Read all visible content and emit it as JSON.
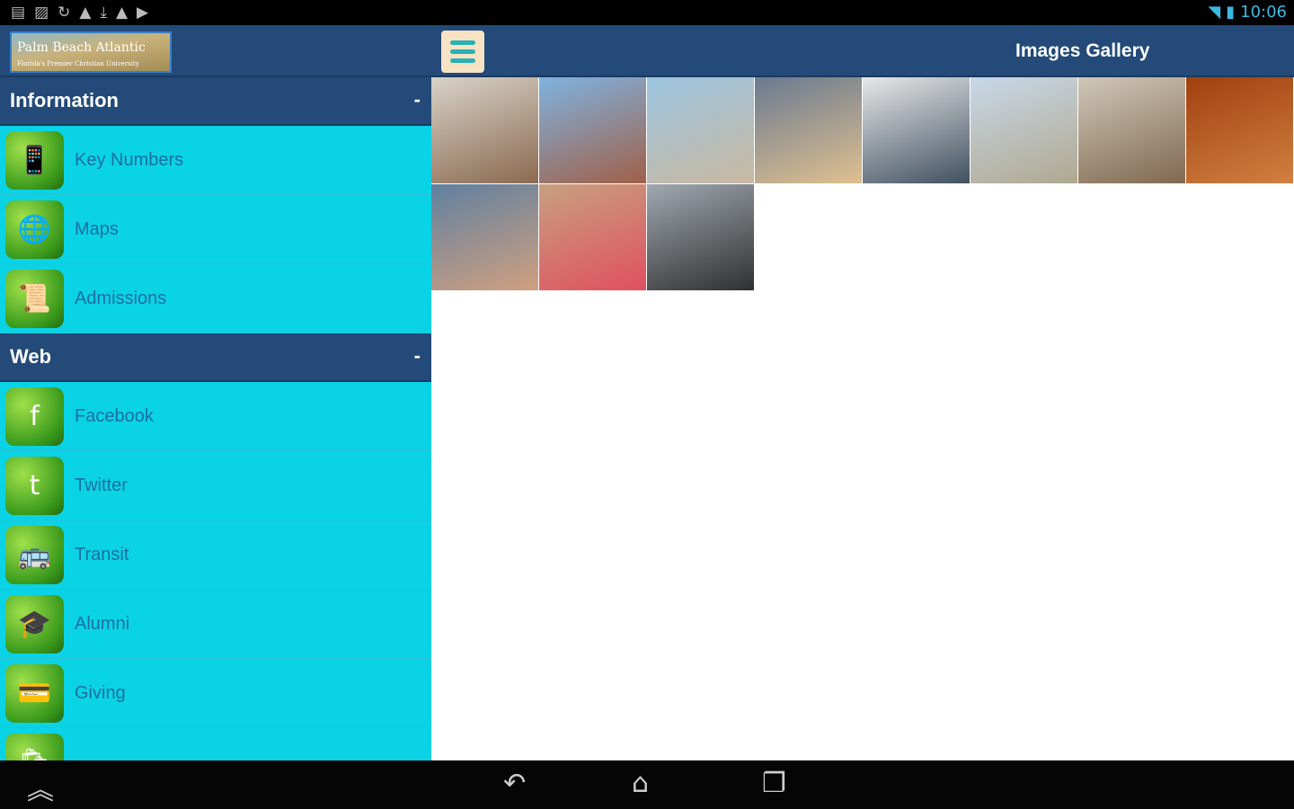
{
  "status_bar": {
    "time": "10:06",
    "icons": [
      "notes-icon",
      "image-icon",
      "sync-icon",
      "warning-icon",
      "download-icon",
      "warning-icon",
      "play-store-icon"
    ]
  },
  "header": {
    "logo_title": "Palm Beach Atlantic",
    "logo_subtitle": "Florida's Premier Christian University",
    "title": "Images Gallery"
  },
  "sidebar": {
    "sections": [
      {
        "title": "Information",
        "toggle": "-",
        "items": [
          {
            "label": "Key Numbers",
            "icon": "📱"
          },
          {
            "label": "Maps",
            "icon": "🌐"
          },
          {
            "label": "Admissions",
            "icon": "📜"
          }
        ]
      },
      {
        "title": "Web",
        "toggle": "-",
        "items": [
          {
            "label": "Facebook",
            "icon": "f"
          },
          {
            "label": "Twitter",
            "icon": "t"
          },
          {
            "label": "Transit",
            "icon": "🚌"
          },
          {
            "label": "Alumni",
            "icon": "🎓"
          },
          {
            "label": "Giving",
            "icon": "💳"
          },
          {
            "label": "",
            "icon": "🛍"
          }
        ]
      }
    ]
  },
  "gallery": {
    "tiles": [
      [
        "#d8d2c8",
        "#8b6a50"
      ],
      [
        "#7fb3e0",
        "#a06048"
      ],
      [
        "#9cc4e0",
        "#c8b8a0"
      ],
      [
        "#6a7a90",
        "#e0c090"
      ],
      [
        "#e8e8e8",
        "#405060"
      ],
      [
        "#c8d8e8",
        "#b0a890"
      ],
      [
        "#d0c8b8",
        "#806850"
      ],
      [
        "#a04010",
        "#d08040"
      ],
      [
        "#6080a0",
        "#d0a080"
      ],
      [
        "#c8a080",
        "#e05060"
      ],
      [
        "#a0a8b0",
        "#303030"
      ]
    ]
  },
  "nav": {
    "icons": [
      "scroll-up-icon",
      "back-icon",
      "home-icon",
      "recents-icon"
    ]
  }
}
